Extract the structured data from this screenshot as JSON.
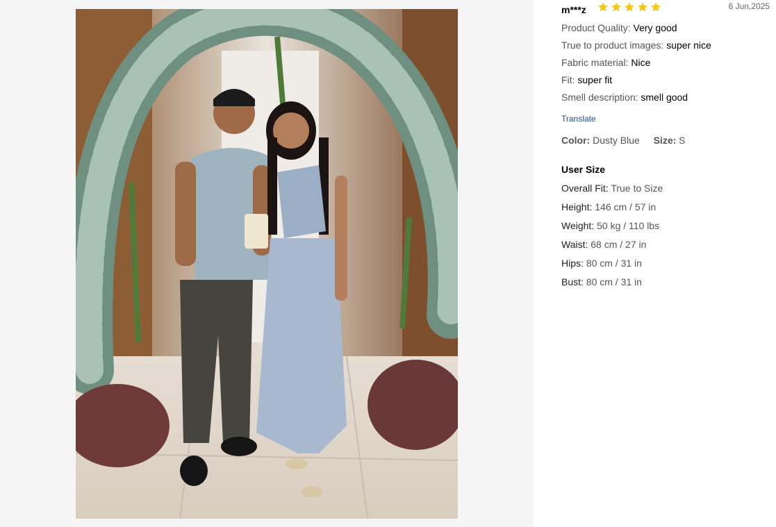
{
  "review": {
    "reviewer": "m***z",
    "rating": 5,
    "star_color": "#f5c518",
    "date": "6 Jun,2025",
    "attributes": [
      {
        "label": "Product Quality:",
        "value": "Very good"
      },
      {
        "label": "True to product images:",
        "value": "super nice"
      },
      {
        "label": "Fabric material:",
        "value": "Nice"
      },
      {
        "label": "Fit:",
        "value": "super fit"
      },
      {
        "label": "Smell description:",
        "value": "smell good"
      }
    ],
    "translate_label": "Translate",
    "color_label": "Color:",
    "color_value": "Dusty Blue",
    "size_label": "Size:",
    "size_value": "S"
  },
  "user_size": {
    "title": "User Size",
    "rows": [
      {
        "label": "Overall Fit:",
        "value": "True to Size"
      },
      {
        "label": "Height:",
        "value": "146 cm / 57 in"
      },
      {
        "label": "Weight:",
        "value": "50 kg / 110 lbs"
      },
      {
        "label": "Waist:",
        "value": "68 cm / 27 in"
      },
      {
        "label": "Hips:",
        "value": "80 cm / 31 in"
      },
      {
        "label": "Bust:",
        "value": "80 cm / 31 in"
      }
    ]
  },
  "photo": {
    "icon": "review-photo"
  }
}
